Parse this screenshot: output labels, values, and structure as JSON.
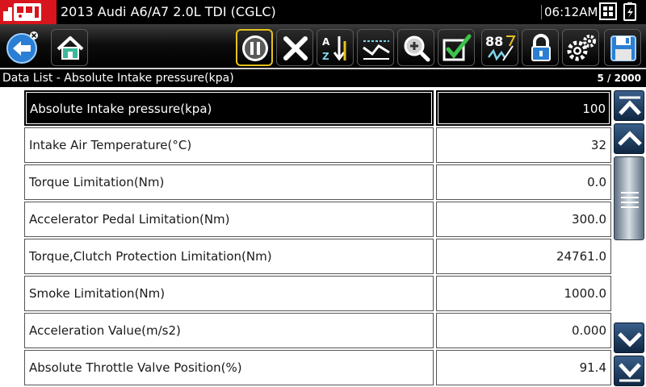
{
  "titlebar": {
    "vehicle": "2013 Audi A6/A7 2.0L TDI (CGLC)",
    "time": "06:12AM"
  },
  "toolbar": {
    "buttons": [
      {
        "name": "back",
        "icon": "back-arrow-icon"
      },
      {
        "name": "home",
        "icon": "home-icon"
      },
      {
        "name": "pause",
        "icon": "pause-icon",
        "highlighted": true
      },
      {
        "name": "clear",
        "icon": "x-icon"
      },
      {
        "name": "sort",
        "icon": "sort-az-icon"
      },
      {
        "name": "graph",
        "icon": "graph-icon"
      },
      {
        "name": "zoom",
        "icon": "zoom-icon"
      },
      {
        "name": "select",
        "icon": "checkmark-icon"
      },
      {
        "name": "units",
        "icon": "units-88-icon",
        "label": "88"
      },
      {
        "name": "lock",
        "icon": "lock-icon"
      },
      {
        "name": "settings",
        "icon": "gears-icon"
      },
      {
        "name": "save",
        "icon": "floppy-disk-icon"
      }
    ]
  },
  "list": {
    "title": "Data List - Absolute Intake pressure(kpa)",
    "page": "5 / 2000"
  },
  "rows": [
    {
      "label": "Absolute Intake pressure(kpa)",
      "value": "100",
      "selected": true
    },
    {
      "label": "Intake Air Temperature(°C)",
      "value": "32"
    },
    {
      "label": "Torque Limitation(Nm)",
      "value": "0.0"
    },
    {
      "label": "Accelerator Pedal Limitation(Nm)",
      "value": "300.0"
    },
    {
      "label": "Torque,Clutch Protection Limitation(Nm)",
      "value": "24761.0"
    },
    {
      "label": "Smoke Limitation(Nm)",
      "value": "1000.0"
    },
    {
      "label": "Acceleration Value(m/s2)",
      "value": "0.000"
    },
    {
      "label": "Absolute Throttle Valve Position(%)",
      "value": "91.4"
    }
  ],
  "colors": {
    "logo_red": "#d8141c",
    "highlight_yellow": "#e7c21a",
    "icon_blue": "#2a7fd4",
    "scroll_blue": "#1d3a5c"
  }
}
